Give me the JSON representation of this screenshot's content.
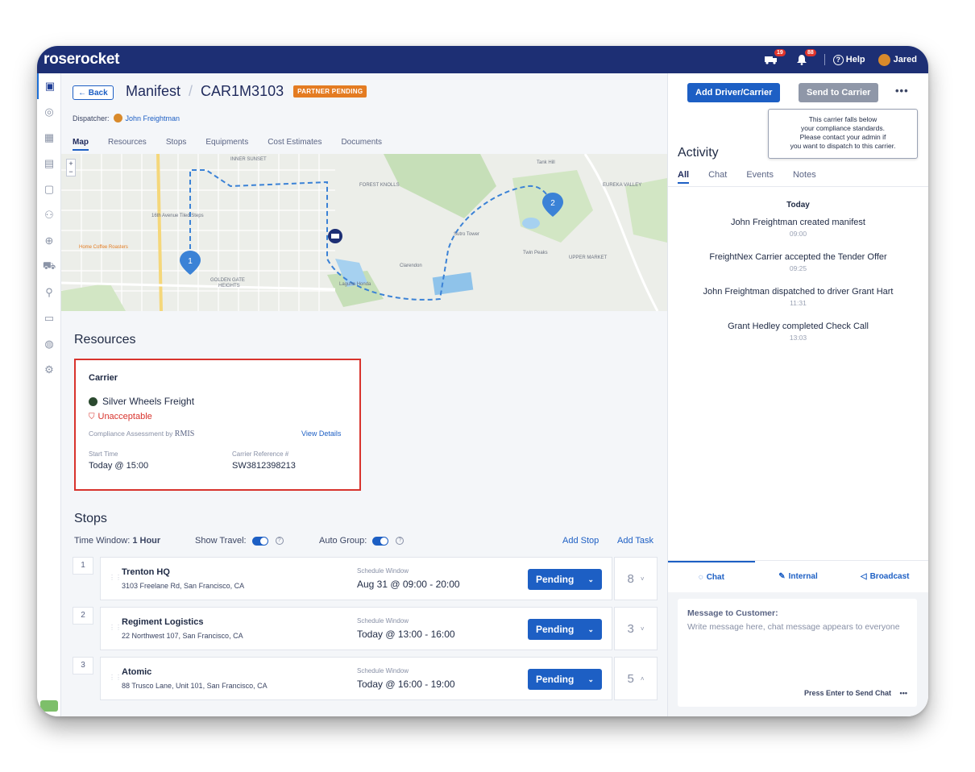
{
  "app": {
    "logo": "roserocket"
  },
  "topbar": {
    "truck_badge": "19",
    "bell_badge": "88",
    "help_label": "Help",
    "user_name": "Jared"
  },
  "header": {
    "back_label": "← Back",
    "section": "Manifest",
    "separator": "/",
    "manifest_id": "CAR1M3103",
    "status_badge": "PARTNER PENDING",
    "dispatcher_label": "Dispatcher:",
    "dispatcher_name": "John Freightman"
  },
  "tabs": [
    "Map",
    "Resources",
    "Stops",
    "Equipments",
    "Cost Estimates",
    "Documents"
  ],
  "map": {
    "labels": {
      "inner_sunset": "INNER SUNSET",
      "forest_knolls": "FOREST KNOLLS",
      "eureka_valley": "EUREKA VALLEY",
      "golden_gate": "GOLDEN GATE",
      "heights": "HEIGHTS",
      "upper_market": "UPPER MARKET",
      "twin_peaks": "Twin Peaks",
      "sutro_tower": "Sutro Tower",
      "home_coffee": "Home Coffee Roasters",
      "laguna_honda": "Laguna Honda",
      "clarendon": "Clarendon",
      "tank_hill": "Tank Hill",
      "moraga_steps": "16th Avenue Tiled Steps"
    },
    "pin_1": "1",
    "pin_2": "2"
  },
  "resources": {
    "title": "Resources",
    "carrier_heading": "Carrier",
    "carrier_name": "Silver Wheels Freight",
    "compliance_status": "Unacceptable",
    "compliance_label": "Compliance Assessment by",
    "compliance_provider": "RMIS",
    "view_details": "View Details",
    "start_time_label": "Start Time",
    "start_time_value": "Today @ 15:00",
    "carrier_ref_label": "Carrier Reference #",
    "carrier_ref_value": "SW3812398213"
  },
  "stops": {
    "title": "Stops",
    "time_window_label": "Time Window:",
    "time_window_value": "1 Hour",
    "show_travel_label": "Show Travel:",
    "auto_group_label": "Auto Group:",
    "add_stop": "Add Stop",
    "add_task": "Add Task",
    "schedule_label": "Schedule Window",
    "items": [
      {
        "num": "1",
        "name": "Trenton HQ",
        "address": "3103 Freelane Rd, San Francisco, CA",
        "window": "Aug 31 @ 09:00 - 20:00",
        "status": "Pending",
        "count": "8",
        "chevron": "˅"
      },
      {
        "num": "2",
        "name": "Regiment Logistics",
        "address": "22 Northwest 107, San Francisco, CA",
        "window": "Today @ 13:00 - 16:00",
        "status": "Pending",
        "count": "3",
        "chevron": "˅"
      },
      {
        "num": "3",
        "name": "Atomic",
        "address": "88 Trusco Lane, Unit 101, San Francisco, CA",
        "window": "Today @ 16:00 - 19:00",
        "status": "Pending",
        "count": "5",
        "chevron": "˄"
      }
    ]
  },
  "actions": {
    "add_driver": "Add Driver/Carrier",
    "send_to_carrier": "Send to Carrier",
    "more": "•••",
    "tooltip_lines": [
      "This carrier falls below",
      "your compliance standards.",
      "Please contact your admin if",
      "you want to dispatch to this carrier."
    ]
  },
  "activity": {
    "title": "Activity",
    "tabs": [
      "All",
      "Chat",
      "Events",
      "Notes"
    ],
    "day": "Today",
    "items": [
      {
        "text": "John Freightman created manifest",
        "time": "09:00"
      },
      {
        "text": "FreightNex Carrier accepted the Tender Offer",
        "time": "09:25"
      },
      {
        "text": "John Freightman dispatched to driver Grant Hart",
        "time": "11:31"
      },
      {
        "text": "Grant Hedley completed Check Call",
        "time": "13:03"
      }
    ]
  },
  "chat": {
    "tabs": [
      "Chat",
      "Internal",
      "Broadcast"
    ],
    "message_label": "Message to Customer:",
    "placeholder": "Write message here, chat message appears to everyone",
    "send_hint": "Press Enter to Send Chat",
    "more": "•••"
  },
  "colors": {
    "brand_navy": "#1d2f74",
    "accent_blue": "#1d5fc4",
    "warning_orange": "#e47c22",
    "danger_red": "#d8332d"
  }
}
